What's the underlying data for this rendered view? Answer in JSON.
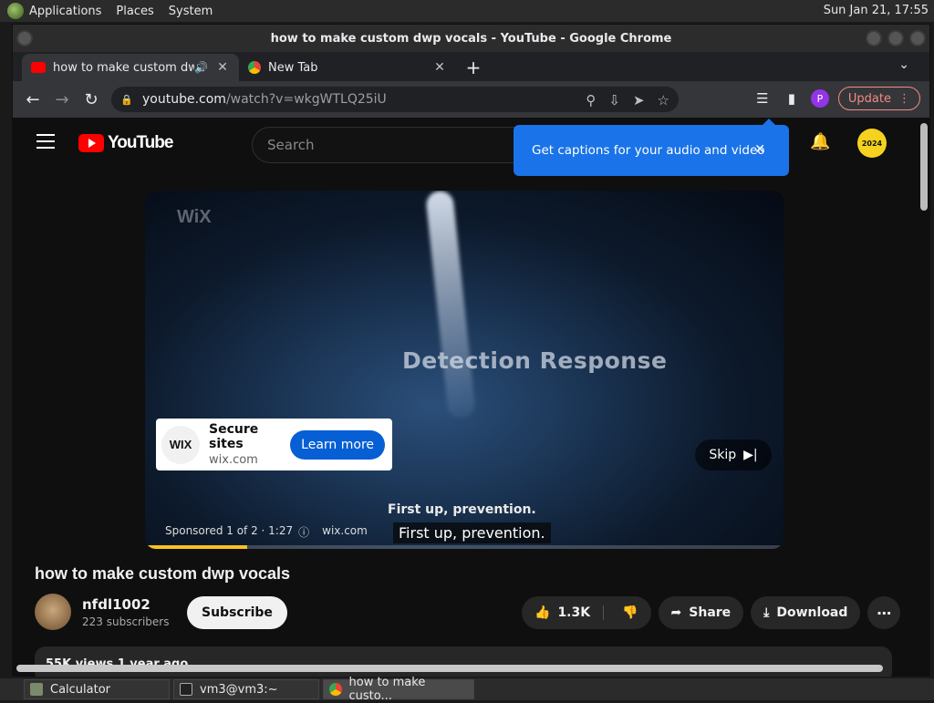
{
  "desktop": {
    "menu": [
      "Applications",
      "Places",
      "System"
    ],
    "clock": "Sun Jan 21, 17:55"
  },
  "window": {
    "title": "how to make custom dwp vocals - YouTube - Google Chrome"
  },
  "tabs": [
    {
      "label": "how to make custom dwp vocals - YouTube",
      "favicon": "youtube-icon",
      "audio": true,
      "active": true
    },
    {
      "label": "New Tab",
      "favicon": "chrome-icon",
      "audio": false,
      "active": false
    }
  ],
  "address": {
    "host": "youtube.com",
    "path": "/watch?v=wkgWTLQ25iU"
  },
  "toolbar": {
    "profile_initial": "P",
    "update_label": "Update"
  },
  "youtube": {
    "logo_text": "YouTube",
    "search_placeholder": "Search",
    "avatar_text": "2024",
    "tooltip": "Get captions for your audio and video"
  },
  "ad": {
    "watermark": "WiX",
    "headline": "Detection Response",
    "card_logo": "WIX",
    "card_title": "Secure sites",
    "card_domain": "wix.com",
    "card_button": "Learn more",
    "skip_label": "Skip",
    "burned_caption": "First up, prevention.",
    "sponsored": "Sponsored 1 of 2 · 1:27",
    "sponsored_domain": "wix.com",
    "caption": "First up, prevention.",
    "progress_percent": 16
  },
  "video": {
    "title": "how to make custom dwp vocals",
    "channel": "nfdl1002",
    "subscribers": "223 subscribers",
    "subscribe_label": "Subscribe",
    "likes": "1.3K",
    "share_label": "Share",
    "download_label": "Download",
    "description_preview": "55K views  1 year ago"
  },
  "taskbar": {
    "items": [
      {
        "label": "Calculator",
        "icon": "calculator-icon"
      },
      {
        "label": "vm3@vm3:~",
        "icon": "terminal-icon"
      },
      {
        "label": "how to make custo...",
        "icon": "chrome-icon"
      }
    ]
  },
  "colors": {
    "accent_blue": "#1a73e8",
    "youtube_red": "#ff0000",
    "ad_progress": "#fcc01f",
    "update_red": "#f28b82"
  }
}
